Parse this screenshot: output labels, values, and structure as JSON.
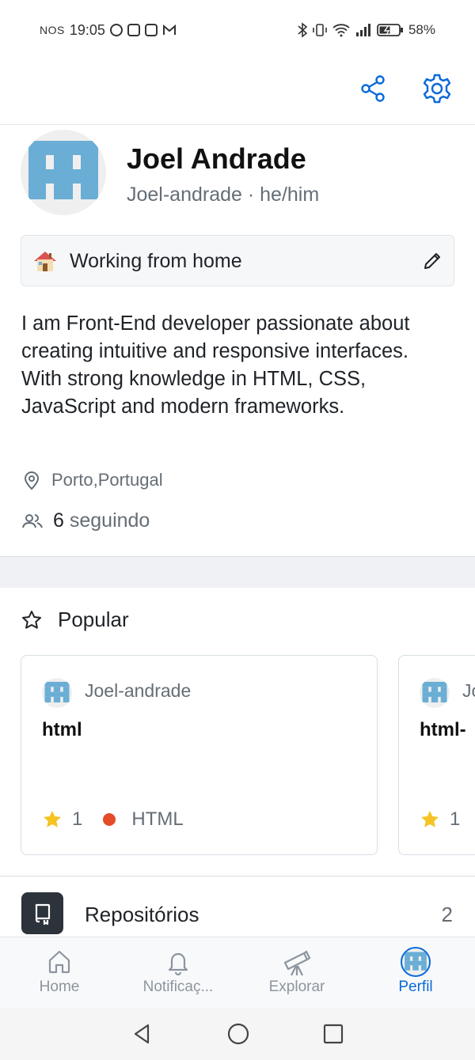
{
  "status_bar": {
    "carrier": "NOS",
    "time": "19:05",
    "battery": "58%"
  },
  "top_bar": {
    "share_icon": "share-icon",
    "settings_icon": "gear-icon"
  },
  "profile": {
    "name": "Joel Andrade",
    "handle_line": "Joel-andrade · he/him",
    "status": {
      "emoji": "house-emoji",
      "text": "Working from home"
    },
    "bio": "I am Front-End developer passionate about creating intuitive and responsive interfaces. With strong knowledge in HTML, CSS, JavaScript and modern frameworks.",
    "location": "Porto,Portugal",
    "following_count": "6",
    "following_label": "seguindo"
  },
  "popular": {
    "title": "Popular",
    "cards": [
      {
        "owner": "Joel-andrade",
        "repo": "html",
        "stars": "1",
        "language": "HTML",
        "language_color": "#e34c26"
      },
      {
        "owner": "Joel-andrade",
        "repo": "html-",
        "stars": "1",
        "language": "",
        "language_color": "#e34c26"
      }
    ]
  },
  "repositories": {
    "label": "Repositórios",
    "count": "2"
  },
  "bottom_nav": {
    "items": [
      {
        "label": "Home"
      },
      {
        "label": "Notificaç..."
      },
      {
        "label": "Explorar"
      },
      {
        "label": "Perfil"
      }
    ]
  },
  "colors": {
    "accent": "#0969da",
    "muted": "#656d76",
    "star": "#f6c324",
    "html_lang": "#e34c26",
    "identicon": "#6aadd5"
  }
}
